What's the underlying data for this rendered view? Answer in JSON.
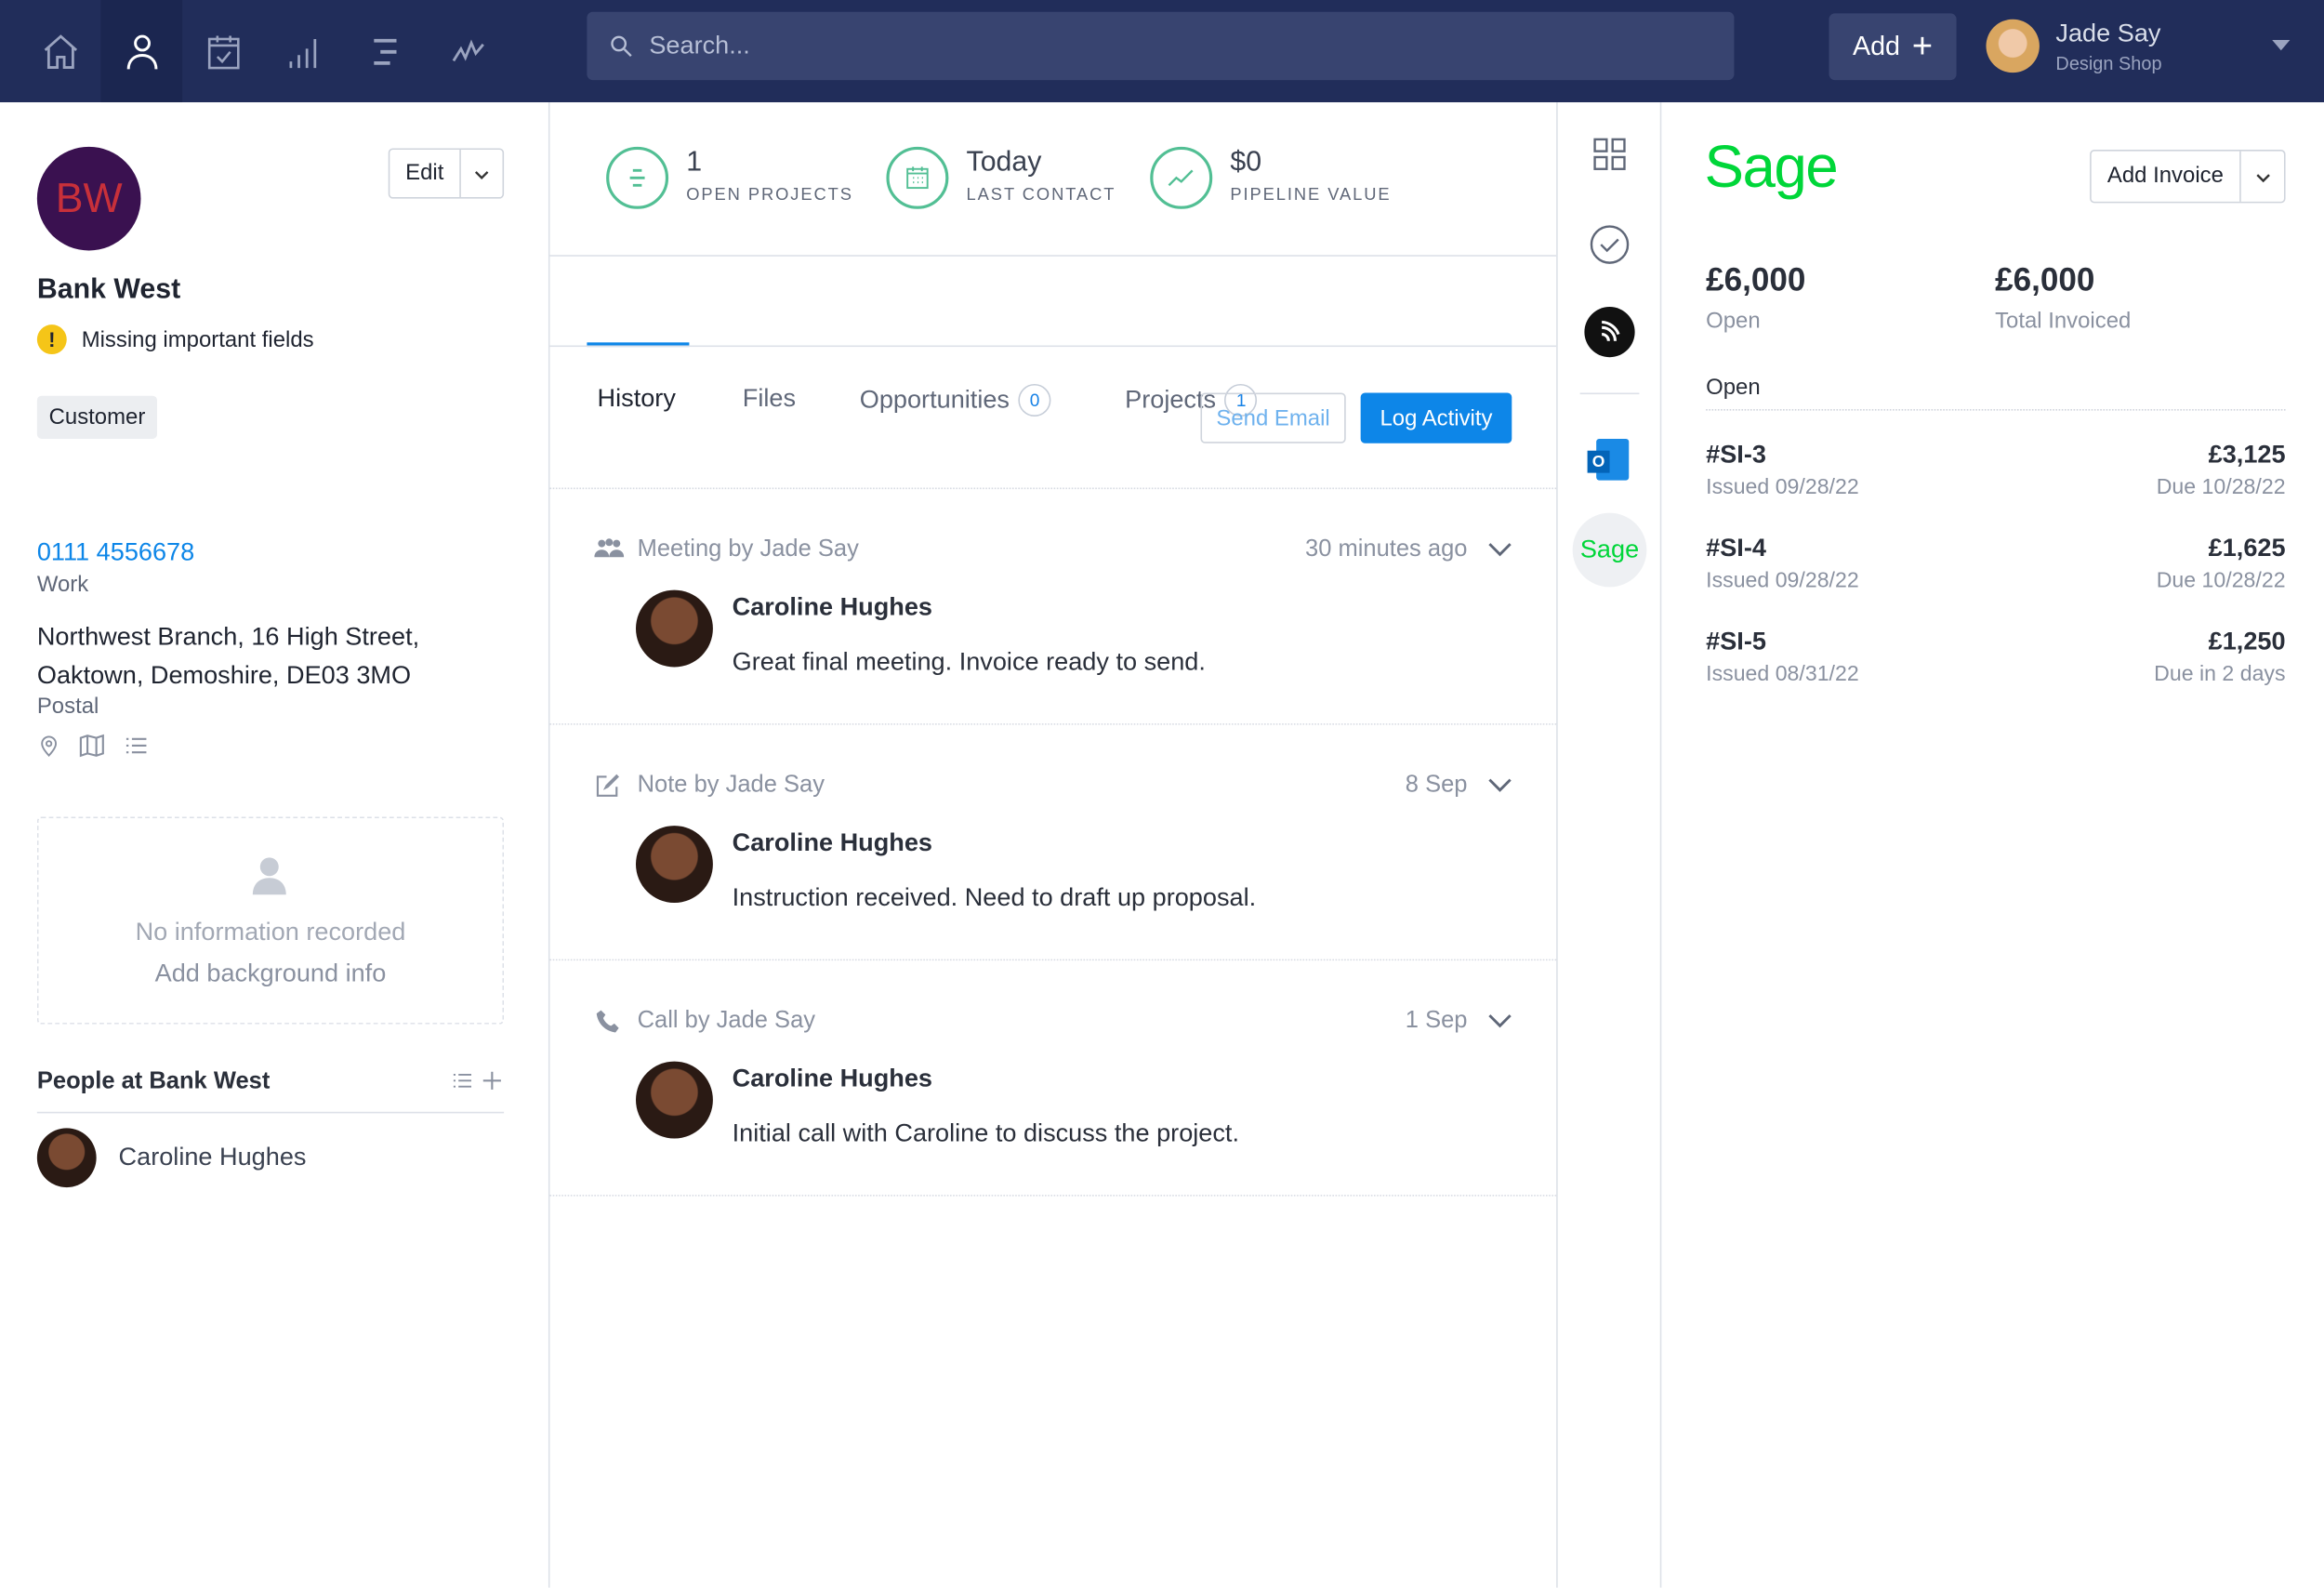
{
  "nav": {
    "icons": [
      "home-icon",
      "person-icon",
      "calendar-check-icon",
      "bar-chart-icon",
      "list-icon",
      "activity-icon"
    ],
    "search_placeholder": "Search...",
    "add_label": "Add",
    "user": {
      "name": "Jade Say",
      "company": "Design Shop"
    }
  },
  "company": {
    "initials": "BW",
    "name": "Bank West",
    "edit_label": "Edit",
    "warning": "Missing important fields",
    "tag": "Customer",
    "phone": "0111 4556678",
    "phone_type": "Work",
    "address_line1": "Northwest Branch, 16 High Street,",
    "address_line2": "Oaktown, Demoshire, DE03 3MO",
    "address_type": "Postal",
    "background_empty": "No information recorded",
    "background_add": "Add background info",
    "people_title": "People at Bank West",
    "people": [
      {
        "name": "Caroline Hughes"
      }
    ]
  },
  "stats": [
    {
      "value": "1",
      "label": "OPEN PROJECTS",
      "icon": "lines-icon"
    },
    {
      "value": "Today",
      "label": "LAST CONTACT",
      "icon": "calendar-icon"
    },
    {
      "value": "$0",
      "label": "PIPELINE VALUE",
      "icon": "trend-icon"
    }
  ],
  "tabs": [
    {
      "label": "History",
      "active": true
    },
    {
      "label": "Files"
    },
    {
      "label": "Opportunities",
      "count": "0"
    },
    {
      "label": "Projects",
      "count": "1"
    }
  ],
  "actions": {
    "send_email": "Send Email",
    "log_activity": "Log Activity"
  },
  "history": [
    {
      "type": "Meeting by Jade Say",
      "icon": "people-icon",
      "time": "30 minutes ago",
      "person": "Caroline Hughes",
      "text": "Great final meeting. Invoice ready to send."
    },
    {
      "type": "Note by Jade Say",
      "icon": "edit-icon",
      "time": "8 Sep",
      "person": "Caroline Hughes",
      "text": "Instruction received. Need to draft up proposal."
    },
    {
      "type": "Call by Jade Say",
      "icon": "phone-icon",
      "time": "1 Sep",
      "person": "Caroline Hughes",
      "text": "Initial call with Caroline to discuss the project."
    }
  ],
  "rail": {
    "sage_label": "Sage"
  },
  "sage": {
    "logo": "Sage",
    "add_invoice": "Add Invoice",
    "open_amount": "£6,000",
    "open_label": "Open",
    "total_amount": "£6,000",
    "total_label": "Total Invoiced",
    "section_title": "Open",
    "invoices": [
      {
        "id": "#SI-3",
        "issued": "Issued 09/28/22",
        "amount": "£3,125",
        "due": "Due 10/28/22"
      },
      {
        "id": "#SI-4",
        "issued": "Issued 09/28/22",
        "amount": "£1,625",
        "due": "Due 10/28/22"
      },
      {
        "id": "#SI-5",
        "issued": "Issued 08/31/22",
        "amount": "£1,250",
        "due": "Due in 2 days"
      }
    ]
  },
  "colors": {
    "nav": "#212d5a",
    "accent": "#0d86e8",
    "stat_green": "#52bf94",
    "sage_green": "#00d639",
    "avatar_bg": "#3a1150",
    "avatar_text": "#c8303a"
  }
}
